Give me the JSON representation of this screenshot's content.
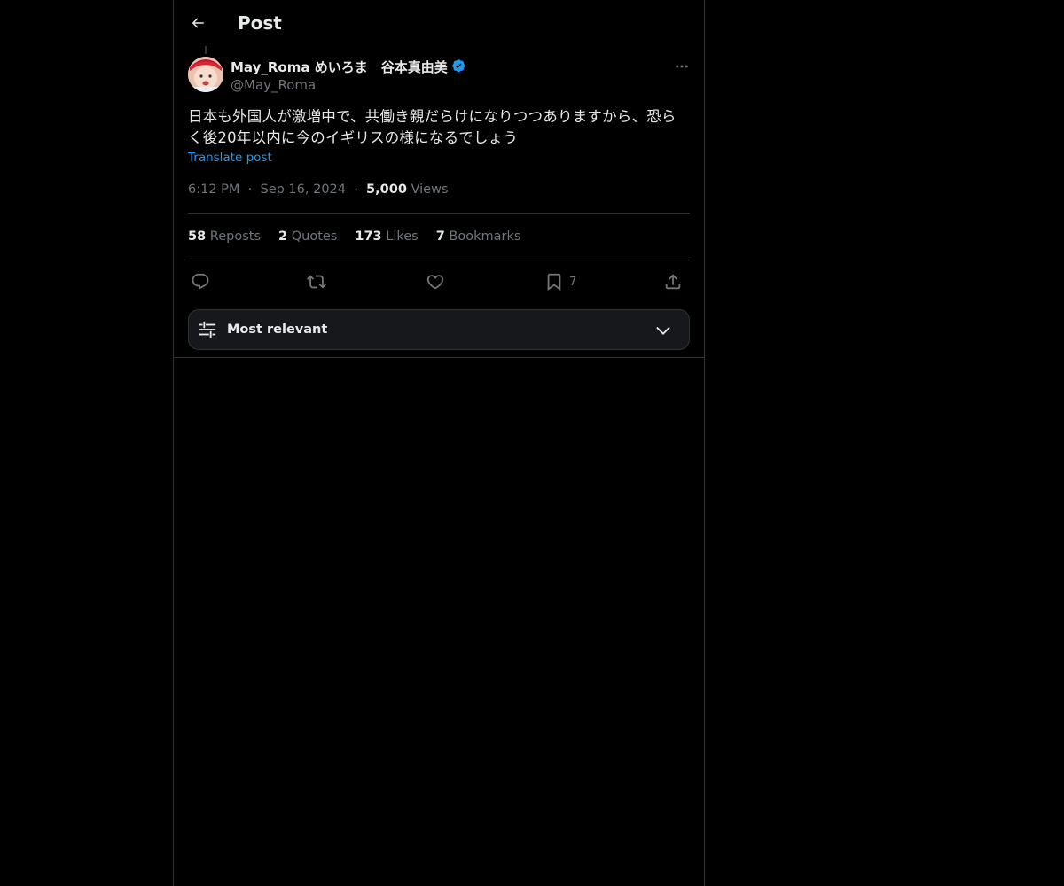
{
  "header": {
    "title": "Post",
    "back_icon": "arrow-left-icon"
  },
  "author": {
    "display_name": "May_Roma めいろま　谷本真由美",
    "handle": "@May_Roma",
    "verified": true,
    "verified_color": "#1d9bf0"
  },
  "post": {
    "text": "日本も外国人が激増中で、共働き親だらけになりつつありますから、恐らく後20年以内に今のイギリスの様になるでしょう",
    "translate_label": "Translate post",
    "time": "6:12 PM",
    "date": "Sep 16, 2024",
    "views_count": "5,000",
    "views_label": "Views",
    "separator": "·"
  },
  "stats": [
    {
      "count": "58",
      "label": "Reposts"
    },
    {
      "count": "2",
      "label": "Quotes"
    },
    {
      "count": "173",
      "label": "Likes"
    },
    {
      "count": "7",
      "label": "Bookmarks"
    }
  ],
  "actions": {
    "reply_icon": "reply-icon",
    "repost_icon": "repost-icon",
    "like_icon": "heart-icon",
    "bookmark_icon": "bookmark-icon",
    "bookmark_count": "7",
    "share_icon": "share-icon"
  },
  "sort": {
    "label": "Most relevant"
  },
  "colors": {
    "background": "#000000",
    "text_primary": "#e7e9ea",
    "text_secondary": "#71767b",
    "accent": "#1d9bf0",
    "border": "#2f3336"
  }
}
